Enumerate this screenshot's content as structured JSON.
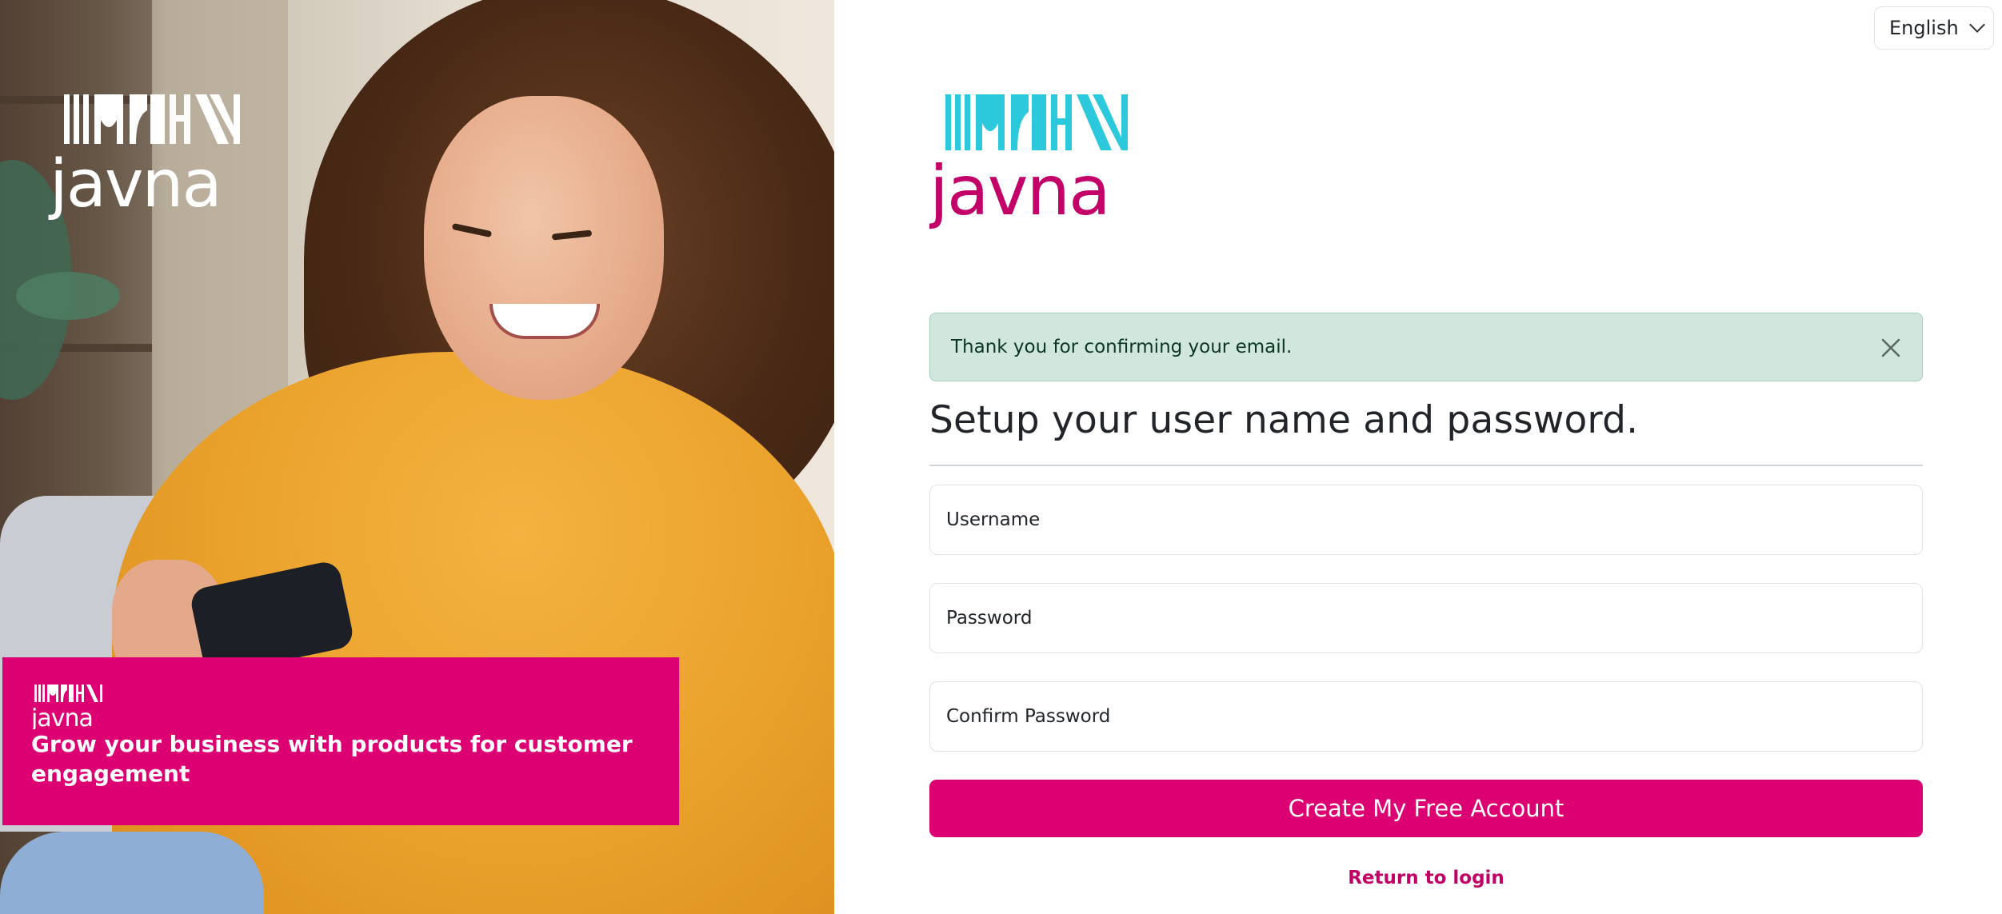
{
  "brand": {
    "name": "javna",
    "primary_color": "#dc0073",
    "accent_color": "#2cc9dc"
  },
  "hero": {
    "image_description_icon": "woman-with-phone-photo",
    "promo_text": "Grow your business with products for customer engagement"
  },
  "language_selector": {
    "selected": "English",
    "icon": "chevron-down-icon"
  },
  "alert": {
    "message": "Thank you for confirming your email.",
    "type": "success",
    "close_icon": "close-icon"
  },
  "form": {
    "title": "Setup your user name and password.",
    "username_placeholder": "Username",
    "password_placeholder": "Password",
    "confirm_password_placeholder": "Confirm Password",
    "submit_label": "Create My Free Account",
    "return_link": "Return to login"
  }
}
